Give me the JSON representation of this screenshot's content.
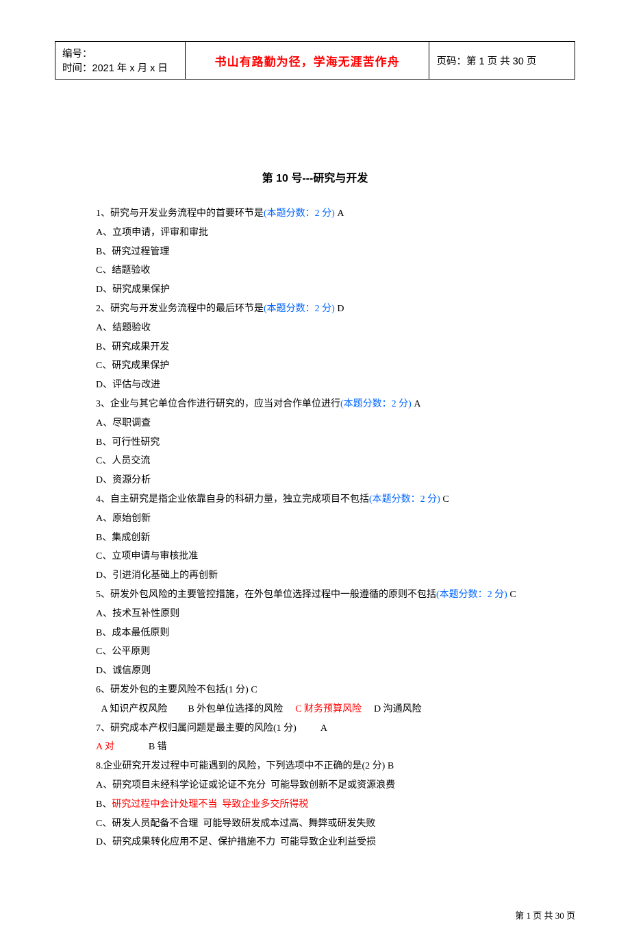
{
  "header": {
    "serial_label": "编号：",
    "time_label": "时间：2021 年 x 月 x 日",
    "maxim": "书山有路勤为径，学海无涯苦作舟",
    "page_label_prefix": "页码：第 ",
    "page_current": "1",
    "page_mid": " 页  共 ",
    "page_total": "30",
    "page_suffix": " 页"
  },
  "title": "第 10 号---研究与开发",
  "q1": {
    "stem_a": "1、研究与开发业务流程中的首要环节是",
    "score": "(本题分数：2 分)",
    "ans": " A",
    "a": "A、立项申请，评审和审批",
    "b": "B、研究过程管理",
    "c": "C、结题验收",
    "d": "D、研究成果保护"
  },
  "q2": {
    "stem_a": "2、研究与开发业务流程中的最后环节是",
    "score": "(本题分数：2 分)",
    "ans": " D",
    "a": "A、结题验收",
    "b": "B、研究成果开发",
    "c": "C、研究成果保护",
    "d": "D、评估与改进"
  },
  "q3": {
    "stem_a": "3、企业与其它单位合作进行研究的，应当对合作单位进行",
    "score": "(本题分数：2 分)",
    "ans": " A",
    "a": "A、尽职调查",
    "b": "B、可行性研究",
    "c": "C、人员交流",
    "d": "D、资源分析"
  },
  "q4": {
    "stem_a": "4、自主研究是指企业依靠自身的科研力量，独立完成项目不包括",
    "score": "(本题分数：2 分)",
    "ans": " C",
    "a": "A、原始创新",
    "b": "B、集成创新",
    "c": "C、立项申请与审核批准",
    "d": "D、引进消化基础上的再创新"
  },
  "q5": {
    "stem_a": "5、研发外包风险的主要管控措施，在外包单位选择过程中一般遵循的原则不包括",
    "score": "(本题分数：2 分)",
    "ans": " C",
    "a": "A、技术互补性原则",
    "b": "B、成本最低原则",
    "c": "C、公平原则",
    "d": "D、诚信原则"
  },
  "q6": {
    "stem": "6、研发外包的主要风险不包括(1 分) C",
    "opt_a": " A 知识产权风险",
    "opt_b": "B 外包单位选择的风险",
    "opt_c": "C 财务预算风险",
    "opt_d": "D 沟通风险"
  },
  "q7": {
    "stem": "7、研究成本产权归属问题是最主要的风险(1 分)          A",
    "opt_a": "A 对",
    "opt_b": "B 错"
  },
  "q8": {
    "stem": "8.企业研究开发过程中可能遇到的风险，下列选项中不正确的是(2 分) B",
    "a": "A、研究项目未经科学论证或论证不充分  可能导致创新不足或资源浪费",
    "b": "B、研究过程中会计处理不当  导致企业多交所得税",
    "c": "C、研发人员配备不合理  可能导致研发成本过高、舞弊或研发失败",
    "d": "D、研究成果转化应用不足、保护措施不力  可能导致企业利益受损"
  },
  "footer": "第 1 页 共 30 页"
}
